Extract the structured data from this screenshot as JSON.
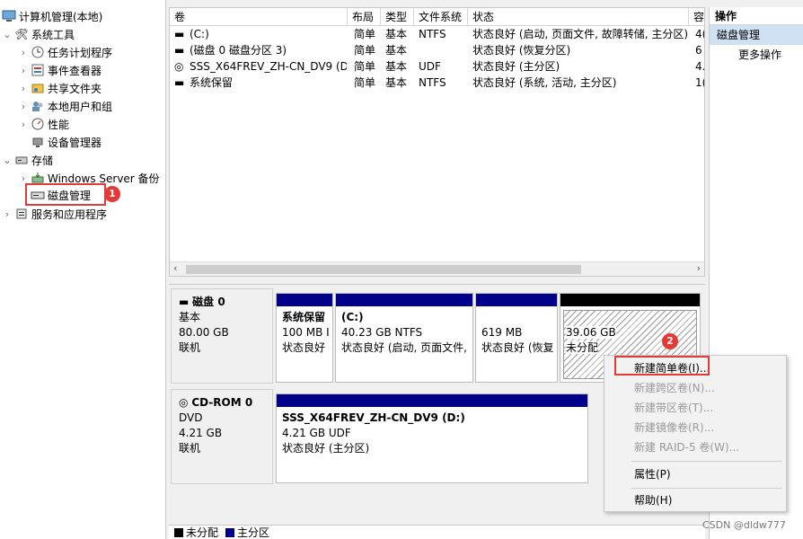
{
  "tree": {
    "root": "计算机管理(本地)",
    "system_tools": "系统工具",
    "task_scheduler": "任务计划程序",
    "event_viewer": "事件查看器",
    "shared_folders": "共享文件夹",
    "local_users": "本地用户和组",
    "performance": "性能",
    "device_manager": "设备管理器",
    "storage": "存储",
    "windows_backup": "Windows Server 备份",
    "disk_management": "磁盘管理",
    "services_apps": "服务和应用程序"
  },
  "volume_list": {
    "headers": [
      "卷",
      "布局",
      "类型",
      "文件系统",
      "状态",
      "容"
    ],
    "rows": [
      {
        "name": "(C:)",
        "layout": "简单",
        "type": "基本",
        "fs": "NTFS",
        "status": "状态良好 (启动, 页面文件, 故障转储, 主分区)",
        "cap": "4("
      },
      {
        "name": "(磁盘 0 磁盘分区 3)",
        "layout": "简单",
        "type": "基本",
        "fs": "",
        "status": "状态良好 (恢复分区)",
        "cap": "6"
      },
      {
        "name": "SSS_X64FREV_ZH-CN_DV9 (D:)",
        "layout": "简单",
        "type": "基本",
        "fs": "UDF",
        "status": "状态良好 (主分区)",
        "cap": "4."
      },
      {
        "name": "系统保留",
        "layout": "简单",
        "type": "基本",
        "fs": "NTFS",
        "status": "状态良好 (系统, 活动, 主分区)",
        "cap": "1("
      }
    ]
  },
  "disk0": {
    "name": "磁盘 0",
    "kind": "基本",
    "size": "80.00 GB",
    "state": "联机",
    "partitions": [
      {
        "title": "系统保留",
        "size": "100 MB I",
        "status": "状态良好"
      },
      {
        "title": "(C:)",
        "size": "40.23 GB NTFS",
        "status": "状态良好 (启动, 页面文件,"
      },
      {
        "title": "",
        "size": "619 MB",
        "status": "状态良好 (恢复"
      },
      {
        "title": "",
        "size": "39.06 GB",
        "status": "未分配"
      }
    ]
  },
  "cdrom0": {
    "name": "CD-ROM 0",
    "kind": "DVD",
    "size": "4.21 GB",
    "state": "联机",
    "partition": {
      "title": "SSS_X64FREV_ZH-CN_DV9  (D:)",
      "size": "4.21 GB UDF",
      "status": "状态良好 (主分区)"
    }
  },
  "legend": {
    "unallocated": "未分配",
    "primary": "主分区"
  },
  "actions": {
    "header": "操作",
    "section": "磁盘管理",
    "more": "更多操作"
  },
  "context_menu": {
    "new_simple": "新建简单卷(I)...",
    "new_spanned": "新建跨区卷(N)...",
    "new_striped": "新建带区卷(T)...",
    "new_mirrored": "新建镜像卷(R)...",
    "new_raid5": "新建 RAID-5 卷(W)...",
    "properties": "属性(P)",
    "help": "帮助(H)"
  },
  "badges": {
    "one": "1",
    "two": "2"
  },
  "watermark": "CSDN @dldw777"
}
